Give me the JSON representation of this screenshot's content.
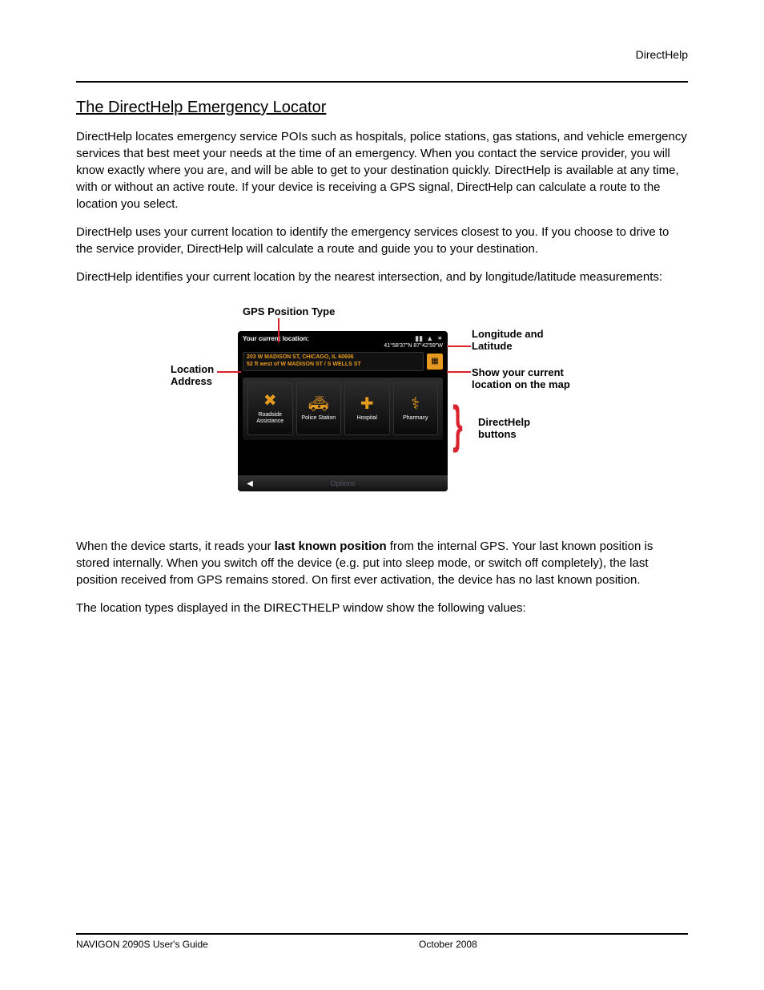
{
  "header": {
    "right": "DirectHelp"
  },
  "section": {
    "title": "The DirectHelp Emergency Locator",
    "p1": "DirectHelp locates emergency service POIs such as hospitals, police stations, gas stations, and vehicle emergency services that best meet your needs at the time of an emergency. When you contact the service provider, you will know exactly where you are, and will be able to get to your destination quickly. DirectHelp is available at any time, with or without an active route. If your device is receiving a GPS signal, DirectHelp can calculate a route to the location you select.",
    "p2": "DirectHelp uses your current location to identify the emergency services closest to you. If you choose to drive to the service provider, DirectHelp will calculate a route and guide you to your destination.",
    "p3": "DirectHelp identifies your current location by the nearest intersection, and by longitude/latitude measurements:",
    "p4_a": "When the device starts, it reads your ",
    "p4_b": "last known position",
    "p4_c": " from the internal GPS. Your last known position is stored internally. When you switch off the device (e.g. put into sleep mode, or switch off completely), the last position received from GPS remains stored. On first ever activation, the device has no last known position.",
    "p5": "The location types displayed in the DIRECTHELP window show the following values:"
  },
  "callouts": {
    "gps": "GPS Position Type",
    "lonlat_a": "Longitude and",
    "lonlat_b": "Latitude",
    "loc_a": "Location",
    "loc_b": "Address",
    "show_a": "Show your current",
    "show_b": "location on the map",
    "dh_a": "DirectHelp",
    "dh_b": "buttons"
  },
  "device": {
    "title": "Your current location:",
    "coords": "41°58'37\"N  87°42'59\"W",
    "addr1": "203 W MADISON ST, CHICAGO, IL 60606",
    "addr2": "52 ft west of W MADISON ST / S WELLS ST",
    "buttons": {
      "roadside": "Roadside Assistance",
      "police": "Police Station",
      "hospital": "Hospital",
      "pharmacy": "Pharmacy"
    },
    "footer": {
      "options": "Options"
    }
  },
  "footer": {
    "left": "NAVIGON 2090S User's Guide",
    "center": "October 2008",
    "right": ""
  }
}
